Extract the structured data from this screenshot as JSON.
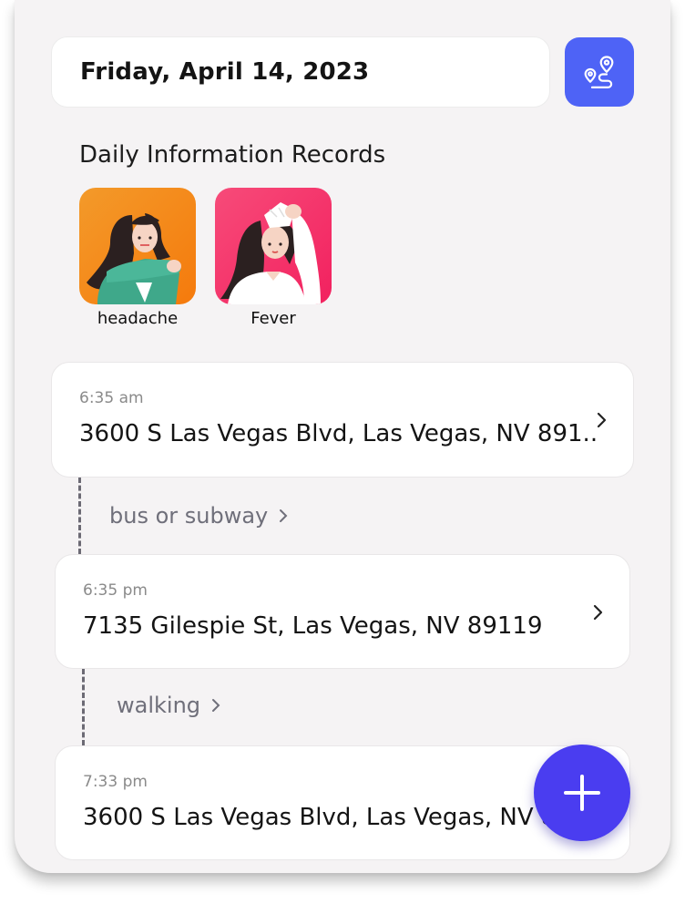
{
  "header": {
    "date": "Friday, April 14, 2023",
    "route_icon": "route-map-icon",
    "accent_color": "#4e63f6"
  },
  "daily": {
    "title": "Daily Information Records",
    "symptoms": [
      {
        "label": "headache",
        "icon": "headache-illustration",
        "color": "#f5820f"
      },
      {
        "label": "Fever",
        "icon": "fever-illustration",
        "color": "#f4306c"
      }
    ]
  },
  "timeline": {
    "entries": [
      {
        "time": "6:35 am",
        "address": "3600 S Las Vegas Blvd, Las Vegas, NV 891.."
      },
      {
        "time": "6:35 pm",
        "address": "7135 Gilespie St, Las Vegas, NV 89119"
      },
      {
        "time": "7:33 pm",
        "address": "3600 S Las Vegas Blvd, Las Vegas, NV 89109"
      }
    ],
    "transits": [
      {
        "label": "bus or subway"
      },
      {
        "label": "walking"
      }
    ]
  },
  "fab": {
    "icon": "plus-icon",
    "color": "#4a3df0"
  }
}
